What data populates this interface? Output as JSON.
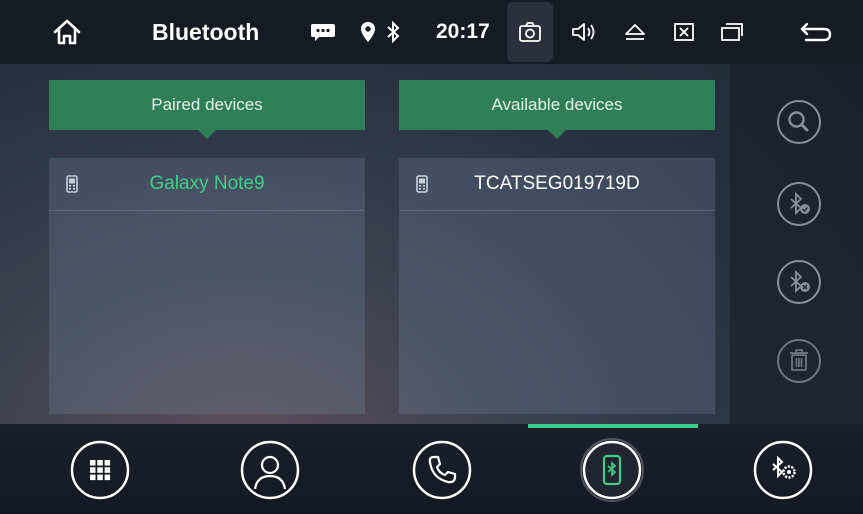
{
  "statusbar": {
    "title": "Bluetooth",
    "time": "20:17",
    "icons": [
      "home-icon",
      "message-icon",
      "location-icon",
      "bluetooth-icon",
      "screenshot-icon",
      "volume-icon",
      "eject-icon",
      "close-window-icon",
      "windows-icon",
      "back-icon"
    ]
  },
  "tabs": {
    "paired": "Paired devices",
    "available": "Available devices"
  },
  "paired_devices": [
    {
      "name": "Galaxy Note9",
      "icon": "phone-icon"
    }
  ],
  "available_devices": [
    {
      "name": "TCATSEG019719D",
      "icon": "phone-icon"
    }
  ],
  "side_actions": [
    "search-icon",
    "bluetooth-connect-icon",
    "bluetooth-disconnect-icon",
    "delete-icon"
  ],
  "bottom_nav": [
    "keypad-icon",
    "contacts-icon",
    "phone-call-icon",
    "bluetooth-devices-icon",
    "bluetooth-settings-icon"
  ],
  "colors": {
    "accent": "#3dcf8a",
    "tab": "#2e7e58",
    "paired_text": "#3dcf8a"
  }
}
